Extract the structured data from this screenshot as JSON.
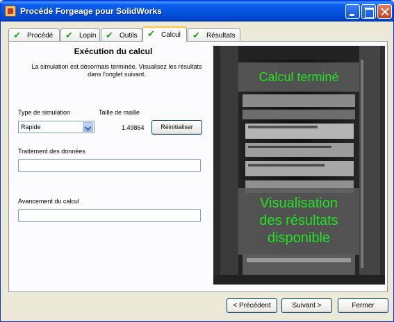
{
  "window": {
    "title": "Procédé Forgeage pour SolidWorks",
    "icon": "forge-app-icon"
  },
  "tabs": [
    {
      "label": "Procédé",
      "done": true,
      "active": false
    },
    {
      "label": "Lopin",
      "done": true,
      "active": false
    },
    {
      "label": "Outils",
      "done": true,
      "active": false
    },
    {
      "label": "Calcul",
      "done": true,
      "active": true
    },
    {
      "label": "Résultats",
      "done": true,
      "active": false
    }
  ],
  "calc": {
    "section_title": "Exécution du calcul",
    "info_line1": "La simulation est désormais terminée. Visualisez les résultats",
    "info_line2": "dans l'onglet suivant.",
    "sim_type_label": "Type de simulation",
    "sim_type_value": "Rapide",
    "mesh_size_label": "Taille de maille",
    "mesh_size_value": "1.49864",
    "reset_button": "Réinitialiser",
    "data_processing_label": "Traitement des données",
    "data_processing_progress": 0,
    "progress_label": "Avancement du calcul",
    "calc_progress": 0
  },
  "image_overlay": {
    "status": "Calcul terminé",
    "message_line1": "Visualisation",
    "message_line2": "des résultats",
    "message_line3": "disponible",
    "text_color": "#22e022"
  },
  "footer": {
    "prev": "< Précédent",
    "next": "Suivant >",
    "close": "Fermer"
  },
  "colors": {
    "titlebar": "#0450dd",
    "tab_check": "#1ea01e",
    "active_tab_accent": "#ffc83c"
  }
}
